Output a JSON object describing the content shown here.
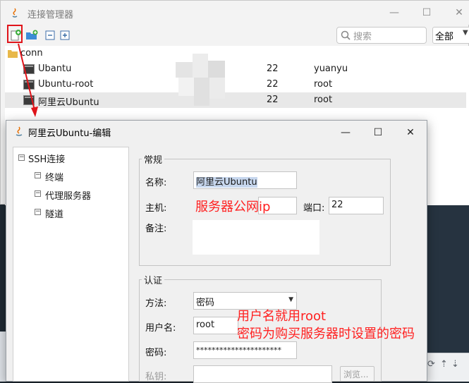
{
  "main_window": {
    "title": "连接管理器",
    "controls": {
      "minimize": "—",
      "maximize": "☐",
      "close": "✕"
    },
    "search": {
      "placeholder": "搜索"
    },
    "filter": {
      "selected": "全部"
    },
    "tree": {
      "root": "conn",
      "items": [
        {
          "name": "Ubantu",
          "port": "22",
          "user": "yuanyu"
        },
        {
          "name": "Ubuntu-root",
          "port": "22",
          "user": "root"
        },
        {
          "name": "阿里云Ubuntu",
          "port": "22",
          "user": "root"
        }
      ]
    }
  },
  "dialog": {
    "title": "阿里云Ubuntu-编辑",
    "controls": {
      "minimize": "—",
      "maximize": "☐",
      "close": "✕"
    },
    "side_tree": {
      "root": "SSH连接",
      "children": [
        "终端",
        "代理服务器",
        "隧道"
      ]
    },
    "general": {
      "title": "常规",
      "name_label": "名称:",
      "name_value": "阿里云Ubuntu",
      "host_label": "主机:",
      "host_value": "",
      "port_label": "端口:",
      "port_value": "22",
      "note_label": "备注:",
      "note_value": ""
    },
    "auth": {
      "title": "认证",
      "method_label": "方法:",
      "method_value": "密码",
      "user_label": "用户名:",
      "user_value": "root",
      "password_label": "密码:",
      "password_value": "**********************",
      "key_label": "私钥:",
      "browse_label": "浏览..."
    }
  },
  "annotations": {
    "host_hint": "服务器公网ip",
    "auth_hint_line1": "用户名就用root",
    "auth_hint_line2": "密码为购买服务器时设置的密码"
  },
  "colors": {
    "annotation_red": "#ff2020",
    "highlight_box": "#e0141a",
    "selection_bg": "#e8e8e8"
  }
}
